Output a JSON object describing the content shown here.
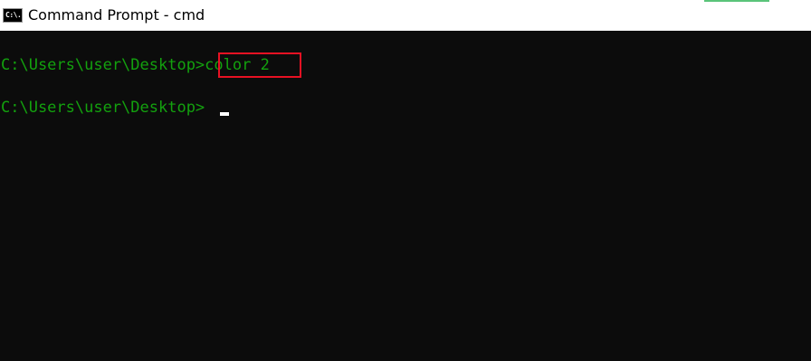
{
  "window": {
    "title": "Command Prompt - cmd",
    "icon": "cmd-icon",
    "icon_glyph": "C:\\."
  },
  "console": {
    "lines": [
      {
        "prompt": "C:\\Users\\user\\Desktop>",
        "command": "color 2"
      },
      {
        "prompt": "C:\\Users\\user\\Desktop>",
        "command": ""
      }
    ],
    "text_color": "#13a10e",
    "background_color": "#0c0c0c",
    "highlight_color": "#e81123"
  }
}
